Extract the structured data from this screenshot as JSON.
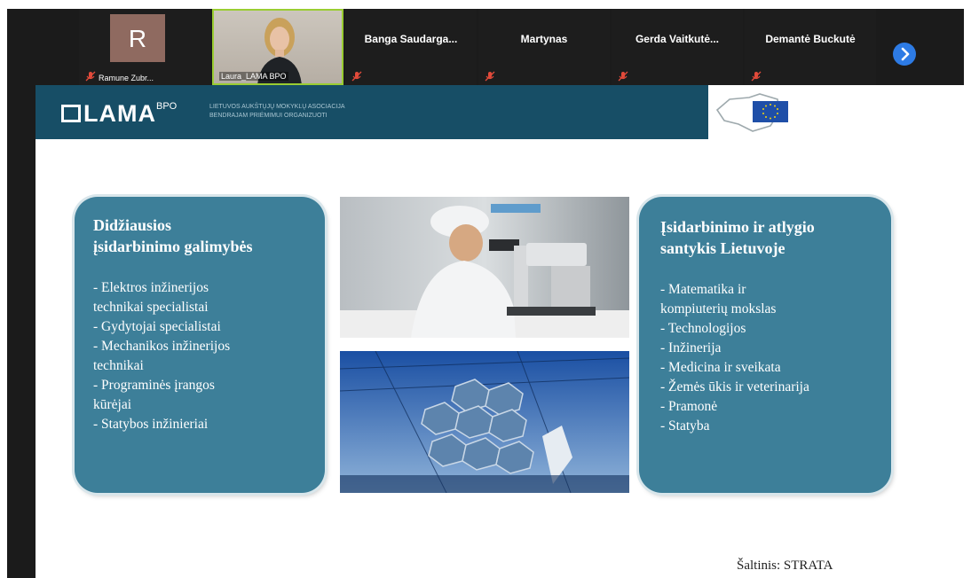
{
  "participants": [
    {
      "name": "Ramune Zubr...",
      "avatar_letter": "R",
      "muted": true
    },
    {
      "name": "Laura_LAMA BPO",
      "muted": false
    },
    {
      "name": "Banga  Saudarga...",
      "muted": true
    },
    {
      "name": "Martynas",
      "muted": true
    },
    {
      "name": "Gerda  Vaitkutė...",
      "muted": true
    },
    {
      "name": "Demantė Buckutė",
      "muted": true
    }
  ],
  "next_icon": "chevron-right-icon",
  "slide": {
    "logo_text": "LAMA",
    "logo_sup": "BPO",
    "assoc_line1": "LIETUVOS AUKŠTŲJŲ MOKYKLŲ ASOCIACIJA",
    "assoc_line2": "BENDRAJAM PRIĖMIMUI ORGANIZUOTI",
    "left_box": {
      "title_line1": "Didžiausios",
      "title_line2": "įsidarbinimo galimybės",
      "items": [
        "- Elektros inžinerijos",
        "technikai specialistai",
        "- Gydytojai specialistai",
        "- Mechanikos inžinerijos",
        "technikai",
        "- Programinės įrangos",
        "kūrėjai",
        "- Statybos inžinieriai"
      ]
    },
    "right_box": {
      "title_line1": "Įsidarbinimo ir atlygio",
      "title_line2": "santykis Lietuvoje",
      "items": [
        "- Matematika ir",
        "kompiuterių mokslas",
        "- Technologijos",
        "- Inžinerija",
        "- Medicina ir sveikata",
        "- Žemės ūkis ir veterinarija",
        "- Pramonė",
        "- Statyba"
      ]
    },
    "source": "Šaltinis: STRATA"
  },
  "colors": {
    "header": "#174e66",
    "box": "#3d7f99",
    "muted_red": "#e24a3a",
    "next_button": "#2d7be5"
  }
}
